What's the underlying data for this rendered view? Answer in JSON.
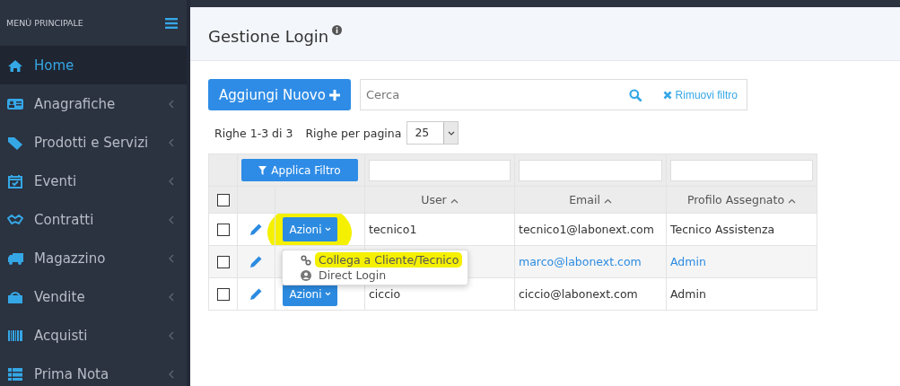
{
  "sidebar": {
    "title": "MENÙ PRINCIPALE",
    "items": [
      {
        "label": "Home",
        "selected": true,
        "expandable": false
      },
      {
        "label": "Anagrafiche",
        "selected": false,
        "expandable": true
      },
      {
        "label": "Prodotti e Servizi",
        "selected": false,
        "expandable": true
      },
      {
        "label": "Eventi",
        "selected": false,
        "expandable": true
      },
      {
        "label": "Contratti",
        "selected": false,
        "expandable": true
      },
      {
        "label": "Magazzino",
        "selected": false,
        "expandable": true
      },
      {
        "label": "Vendite",
        "selected": false,
        "expandable": true
      },
      {
        "label": "Acquisti",
        "selected": false,
        "expandable": true
      },
      {
        "label": "Prima Nota",
        "selected": false,
        "expandable": true
      }
    ]
  },
  "page": {
    "title": "Gestione Login"
  },
  "toolbar": {
    "add_button": "Aggiungi Nuovo",
    "search": {
      "placeholder": "Cerca"
    },
    "remove_filter": "Rimuovi filtro"
  },
  "pagination": {
    "rows_info": "Righe 1-3 di 3",
    "per_page_label": "Righe per pagina",
    "per_page": "25"
  },
  "table": {
    "select_all_checked": false,
    "filter_button": "Applica Filtro",
    "columns": [
      "User",
      "Email",
      "Profilo Assegnato"
    ],
    "rows": [
      {
        "checked": false,
        "action": "Azioni",
        "user": "tecnico1",
        "email": "tecnico1@labonext.com",
        "profile": "Tecnico Assistenza",
        "hovered": false
      },
      {
        "checked": false,
        "email": "marco@labonext.com",
        "profile": "Admin",
        "hovered": true
      },
      {
        "checked": false,
        "action": "Azioni",
        "user": "ciccio",
        "email": "ciccio@labonext.com",
        "profile": "Admin",
        "hovered": false
      }
    ]
  },
  "dropdown": {
    "items": [
      {
        "label": "Collega a Cliente/Tecnico",
        "kind": "link",
        "highlighted": true
      },
      {
        "label": "Direct Login",
        "kind": "user",
        "highlighted": false
      }
    ]
  }
}
